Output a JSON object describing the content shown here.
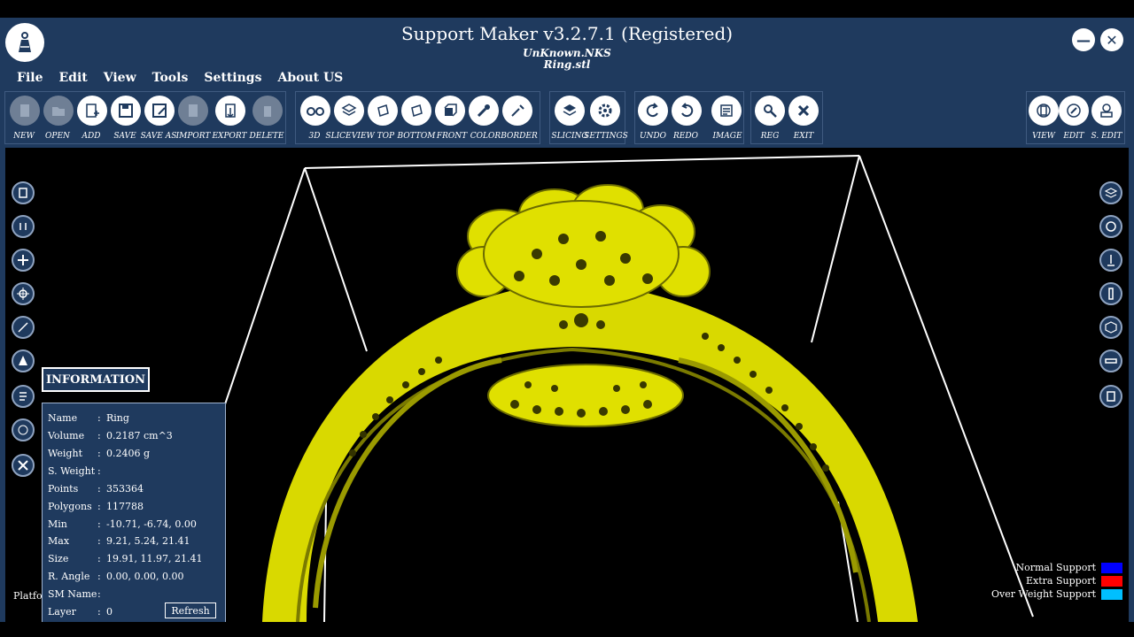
{
  "window": {
    "title": "Support Maker v3.2.7.1 (Registered)",
    "subtitle1": "UnKnown.NKS",
    "subtitle2": "Ring.stl",
    "minimize": "—",
    "close": "✕"
  },
  "menu": [
    "File",
    "Edit",
    "View",
    "Tools",
    "Settings",
    "About US"
  ],
  "toolbar": {
    "new": "NEW",
    "open": "OPEN",
    "add": "ADD",
    "save": "SAVE",
    "save_as": "SAVE AS",
    "import": "IMPORT",
    "export": "EXPORT",
    "delete": "DELETE",
    "d3": "3D",
    "slice": "SLICE",
    "view_top": "VIEW TOP",
    "bottom": "BOTTOM",
    "front": "FRONT",
    "color": "COLOR",
    "border": "BORDER",
    "slicing": "SLICING",
    "settings": "SETTINGS",
    "undo": "UNDO",
    "redo": "REDO",
    "image": "IMAGE",
    "reg": "REG",
    "exit": "EXIT",
    "view": "VIEW",
    "edit": "EDIT",
    "s_edit": "S. EDIT"
  },
  "info": {
    "button": "INFORMATION",
    "rows": [
      {
        "k": "Name",
        "v": "Ring"
      },
      {
        "k": "Volume",
        "v": "0.2187 cm^3"
      },
      {
        "k": "Weight",
        "v": "0.2406 g"
      },
      {
        "k": "S. Weight",
        "v": ""
      },
      {
        "k": "Points",
        "v": "353364"
      },
      {
        "k": "Polygons",
        "v": "117788"
      },
      {
        "k": "Min",
        "v": "-10.71, -6.74, 0.00"
      },
      {
        "k": "Max",
        "v": "9.21, 5.24, 21.41"
      },
      {
        "k": "Size",
        "v": "19.91, 11.97, 21.41"
      },
      {
        "k": "R. Angle",
        "v": "0.00, 0.00, 0.00"
      },
      {
        "k": "SM Name",
        "v": ""
      },
      {
        "k": "Layer",
        "v": "0"
      }
    ],
    "refresh": "Refresh"
  },
  "platform_label": "Platfo",
  "legend": [
    {
      "label": "Normal Support",
      "color": "#0000ff"
    },
    {
      "label": "Extra Support",
      "color": "#ff0000"
    },
    {
      "label": "Over Weight Support",
      "color": "#00bfff"
    }
  ],
  "colors": {
    "panel": "#1f3a5e",
    "model": "#e6e600"
  }
}
